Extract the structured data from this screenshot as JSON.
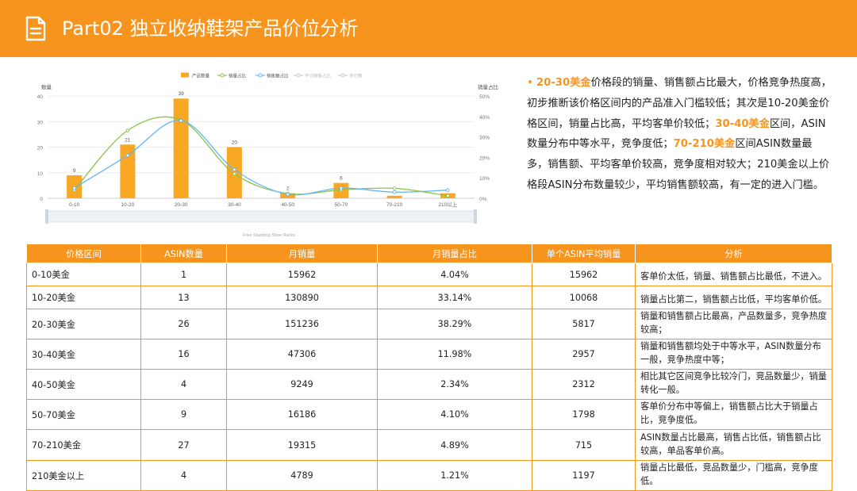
{
  "header": {
    "title": "Part02 独立收纳鞋架产品价位分析",
    "color": "#f7941d",
    "icon": "document-icon"
  },
  "analysis_text": {
    "segments": [
      {
        "text": "• ",
        "hl": "bullet"
      },
      {
        "text": "20-30美金",
        "hl": "yes"
      },
      {
        "text": "价格段的销量、销售额占比最大，价格竞争热度高，初步推断该价格区间内的产品准入门槛较低；其次是10-20美金价格区间，销量占比高，平均客单价较低；",
        "hl": "no"
      },
      {
        "text": "30-40美金",
        "hl": "yes"
      },
      {
        "text": "区间，ASIN数量分布中等水平，竞争度低；",
        "hl": "no"
      },
      {
        "text": "70-210美金",
        "hl": "yes"
      },
      {
        "text": "区间ASIN数量最多，销售额、平均客单价较高，竞争度相对较大；210美金以上价格段ASIN分布数量较少，平均销售额较高，有一定的进入门槛。",
        "hl": "no"
      }
    ]
  },
  "chart_data": {
    "type": "bar",
    "title": "",
    "caption": "Free Standing Shoe Racks",
    "categories": [
      "0-10",
      "10-20",
      "20-30",
      "30-40",
      "40-50",
      "50-70",
      "70-210",
      "210以上"
    ],
    "y_left_label": "数量",
    "y_right_label": "销量占比",
    "y_left_ticks": [
      "0",
      "10",
      "20",
      "30",
      "40"
    ],
    "y_right_ticks": [
      "0%",
      "10%",
      "20%",
      "30%",
      "40%",
      "50%"
    ],
    "ylim_left": [
      0,
      40
    ],
    "ylim_right": [
      0,
      50
    ],
    "legend": [
      "产品数量",
      "销量占比",
      "销售额占比",
      "平均销售占比",
      "评分数"
    ],
    "legend_colors": [
      "#f9a825",
      "#8bc34a",
      "#64b5f6",
      "#cccccc",
      "#cccccc"
    ],
    "series": [
      {
        "name": "产品数量",
        "type": "bar",
        "axis": "left",
        "color": "#f9a825",
        "values": [
          9,
          21,
          39,
          20,
          2,
          6,
          1,
          2
        ],
        "labels": [
          "9",
          "21",
          "39",
          "20",
          "2",
          "6",
          "",
          ""
        ]
      },
      {
        "name": "销量占比",
        "type": "line",
        "axis": "right",
        "color": "#8bc34a",
        "values": [
          4.04,
          33.14,
          38.29,
          11.98,
          2.34,
          4.1,
          4.89,
          1.21
        ]
      },
      {
        "name": "销售额占比",
        "type": "line",
        "axis": "right",
        "color": "#64b5f6",
        "values": [
          5,
          21,
          38,
          14,
          2,
          5,
          3,
          4
        ]
      }
    ],
    "grid": true,
    "legend_position": "top"
  },
  "table": {
    "headers": [
      "价格区间",
      "ASIN数量",
      "月销量",
      "月销量占比",
      "单个ASIN平均销量",
      "分析"
    ],
    "rows": [
      [
        "0-10美金",
        "1",
        "15962",
        "4.04%",
        "15962",
        "客单价太低，销量、销售额占比最低，不进入。"
      ],
      [
        "10-20美金",
        "13",
        "130890",
        "33.14%",
        "10068",
        "销量占比第二，销售额占比低，平均客单价低。"
      ],
      [
        "20-30美金",
        "26",
        "151236",
        "38.29%",
        "5817",
        "销量和销售额占比最高，产品数量多，竞争热度较高；"
      ],
      [
        "30-40美金",
        "16",
        "47306",
        "11.98%",
        "2957",
        "销量和销售额均处于中等水平，ASIN数量分布一般，竞争热度中等；"
      ],
      [
        "40-50美金",
        "4",
        "9249",
        "2.34%",
        "2312",
        "相比其它区间竞争比较冷门，竞品数量少，销量转化一般。"
      ],
      [
        "50-70美金",
        "9",
        "16186",
        "4.10%",
        "1798",
        "客单价分布中等偏上，销售额占比大于销量占比，竞争度低。"
      ],
      [
        "70-210美金",
        "27",
        "19315",
        "4.89%",
        "715",
        "ASIN数量占比最高，销售占比低，销售额占比较高，单品客单价高。"
      ],
      [
        "210美金以上",
        "4",
        "4789",
        "1.21%",
        "1197",
        "销量占比最低，竞品数量少，门槛高，竞争度低。"
      ]
    ]
  }
}
